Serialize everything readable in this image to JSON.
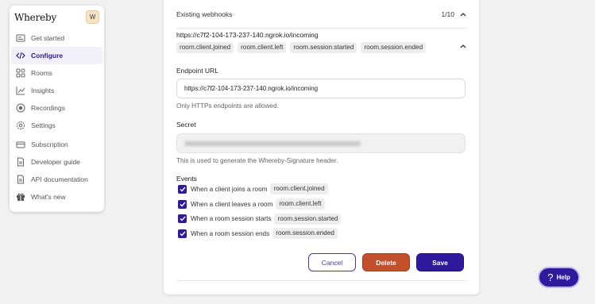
{
  "app": {
    "brand": "Whereby",
    "avatar_initial": "W"
  },
  "sidebar": {
    "items": [
      {
        "label": "Get started",
        "icon": "get-started-icon",
        "active": false
      },
      {
        "label": "Configure",
        "icon": "code-icon",
        "active": true
      },
      {
        "label": "Rooms",
        "icon": "rooms-icon",
        "active": false
      },
      {
        "label": "Insights",
        "icon": "chart-line-icon",
        "active": false
      },
      {
        "label": "Recordings",
        "icon": "record-icon",
        "active": false
      },
      {
        "label": "Settings",
        "icon": "gear-icon",
        "active": false
      },
      {
        "label": "Subscription",
        "icon": "card-icon",
        "active": false
      },
      {
        "label": "Developer guide",
        "icon": "document-icon",
        "active": false
      },
      {
        "label": "API documentation",
        "icon": "document-icon",
        "active": false
      },
      {
        "label": "What's new",
        "icon": "gift-icon",
        "active": false
      }
    ]
  },
  "webhooks": {
    "section_title": "Existing webhooks",
    "count": "1/10",
    "item": {
      "url": "https://c7f2-104-173-237-140.ngrok.io/incoming",
      "events_chips": [
        "room.client.joined",
        "room.client.left",
        "room.session.started",
        "room.session.ended"
      ]
    },
    "form": {
      "endpoint_label": "Endpoint URL",
      "endpoint_value": "https://c7f2-104-173-237-140.ngrok.io/incoming",
      "endpoint_help": "Only HTTPs endpoints are allowed.",
      "secret_label": "Secret",
      "secret_help": "This is used to generate the Whereby-Signature header.",
      "events_label": "Events",
      "events": [
        {
          "label": "When a client joins a room",
          "code": "room.client.joined",
          "checked": true
        },
        {
          "label": "When a client leaves a room",
          "code": "room.client.left",
          "checked": true
        },
        {
          "label": "When a room session starts",
          "code": "room.session.started",
          "checked": true
        },
        {
          "label": "When a room session ends",
          "code": "room.session.ended",
          "checked": true
        }
      ],
      "cancel_label": "Cancel",
      "delete_label": "Delete",
      "save_label": "Save"
    }
  },
  "help": {
    "label": "Help",
    "icon": "?"
  },
  "colors": {
    "primary": "#2e1a9d",
    "danger": "#c3502d",
    "active_bg": "#f2f1f9"
  }
}
